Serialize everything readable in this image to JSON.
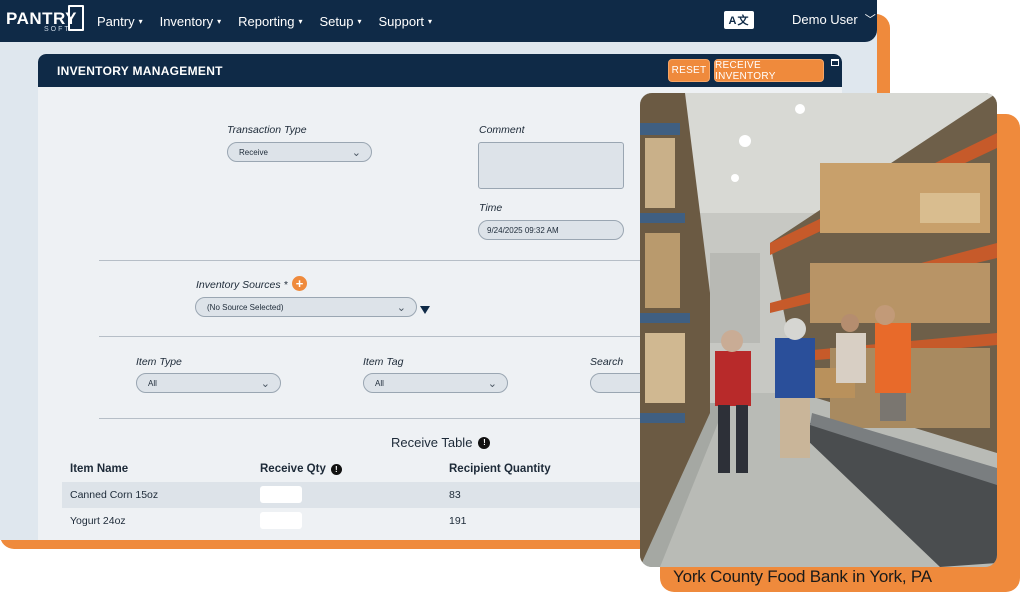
{
  "app": {
    "logo_text": "PANTRY",
    "logo_sub": "SOFT"
  },
  "nav": {
    "items": [
      {
        "label": "Pantry"
      },
      {
        "label": "Inventory"
      },
      {
        "label": "Reporting"
      },
      {
        "label": "Setup"
      },
      {
        "label": "Support"
      }
    ],
    "language_badge": "A文",
    "user_label": "Demo User"
  },
  "panel": {
    "title": "INVENTORY MANAGEMENT",
    "reset_label": "RESET",
    "receive_label": "RECEIVE INVENTORY"
  },
  "form": {
    "transaction_type_label": "Transaction Type",
    "transaction_type_value": "Receive",
    "comment_label": "Comment",
    "time_label": "Time",
    "time_value": "9/24/2025 09:32 AM",
    "inventory_sources_label": "Inventory Sources *",
    "inventory_sources_value": "(No Source Selected)",
    "item_type_label": "Item Type",
    "item_type_value": "All",
    "item_tag_label": "Item Tag",
    "item_tag_value": "All",
    "search_label": "Search"
  },
  "table": {
    "title": "Receive Table",
    "columns": [
      "Item Name",
      "Receive Qty",
      "Recipient Quantity"
    ],
    "rows": [
      {
        "item_name": "Canned Corn 15oz",
        "receive_qty": "",
        "recipient_quantity": "83"
      },
      {
        "item_name": "Yogurt 24oz",
        "receive_qty": "",
        "recipient_quantity": "191"
      }
    ]
  },
  "photo": {
    "caption": "York County Food Bank in York, PA"
  },
  "colors": {
    "navy": "#0f2a47",
    "orange": "#ef8a3c",
    "panel_bg": "#eef1f4"
  }
}
